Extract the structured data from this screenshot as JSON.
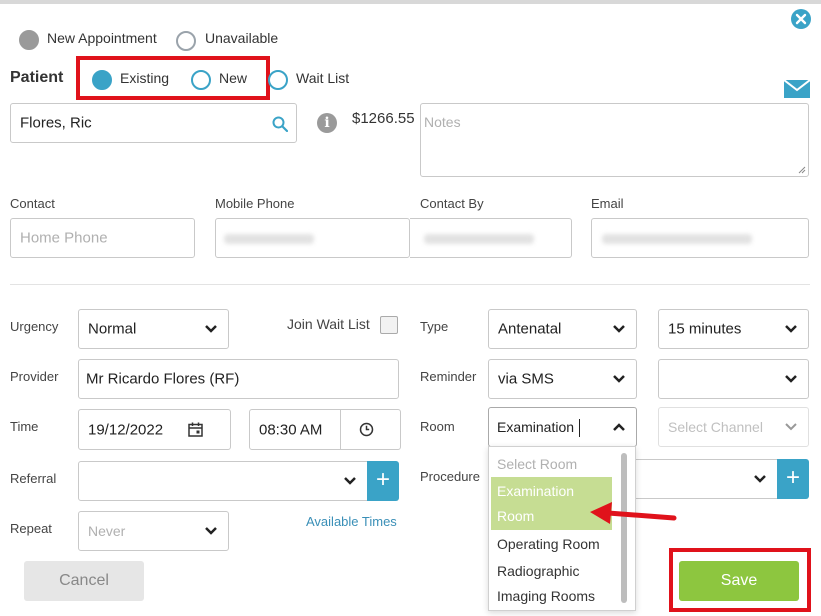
{
  "appointment_type": {
    "options": [
      "New Appointment",
      "Unavailable"
    ],
    "selected": "New Appointment"
  },
  "patient": {
    "label": "Patient",
    "modes": [
      "Existing",
      "New",
      "Wait List"
    ],
    "selected_mode": "Existing",
    "name": "Flores, Ric",
    "balance": "$1266.55",
    "notes_placeholder": "Notes"
  },
  "contact": {
    "contact_label": "Contact",
    "contact_placeholder": "Home Phone",
    "mobile_label": "Mobile Phone",
    "contact_by_label": "Contact By",
    "email_label": "Email"
  },
  "form": {
    "urgency_label": "Urgency",
    "urgency_value": "Normal",
    "join_wait_list_label": "Join Wait List",
    "type_label": "Type",
    "type_value": "Antenatal",
    "duration_value": "15 minutes",
    "provider_label": "Provider",
    "provider_value": "Mr Ricardo Flores (RF)",
    "reminder_label": "Reminder",
    "reminder_value": "via SMS",
    "time_label": "Time",
    "date_value": "19/12/2022",
    "time_value": "08:30 AM",
    "room_label": "Room",
    "room_value": "Examination",
    "channel_placeholder": "Select Channel",
    "referral_label": "Referral",
    "procedure_label": "Procedure",
    "repeat_label": "Repeat",
    "repeat_value": "Never",
    "available_times_link": "Available Times"
  },
  "room_dropdown": {
    "placeholder": "Select Room",
    "highlighted_line1": "Examination",
    "highlighted_line2": "Room",
    "options": [
      "Operating Room",
      "Radiographic",
      "Imaging Rooms"
    ]
  },
  "buttons": {
    "cancel": "Cancel",
    "save": "Save",
    "add": "+"
  },
  "colors": {
    "accent": "#3aa3c7",
    "save_green": "#8dc63f",
    "highlight": "#c6dd93",
    "annotation_red": "#e0121b"
  },
  "icons": [
    "close-icon",
    "mail-icon",
    "search-icon",
    "info-icon",
    "calendar-icon",
    "clock-icon",
    "chevron-down-icon",
    "chevron-up-icon",
    "plus-icon",
    "red-arrow-icon"
  ]
}
